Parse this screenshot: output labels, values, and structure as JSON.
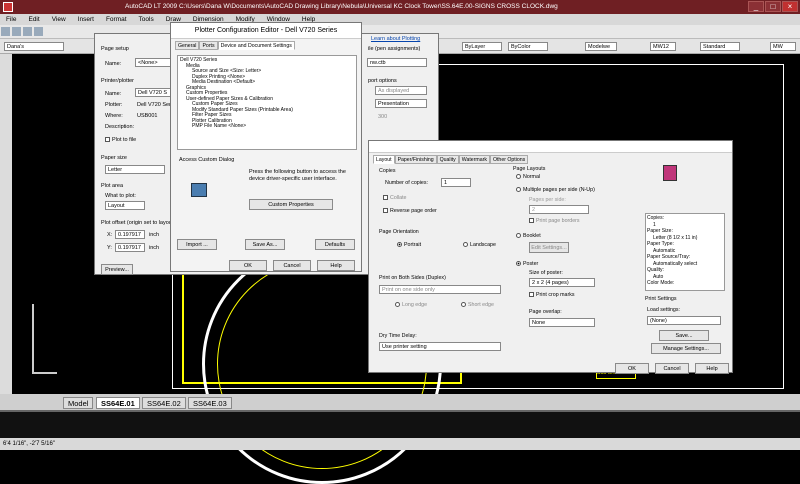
{
  "window": {
    "title": "AutoCAD LT 2009 C:\\Users\\Dana W\\Documents\\AutoCAD Drawing Library\\Nebula\\Universal KC Clock Tower\\SS.64E.00-SIGNS CROSS CLOCK.dwg"
  },
  "menu": [
    "File",
    "Edit",
    "View",
    "Insert",
    "Format",
    "Tools",
    "Draw",
    "Dimension",
    "Modify",
    "Window",
    "Help"
  ],
  "toolbar": {
    "workspace": "Dana's",
    "layer": "ByLayer",
    "color": "ByColor",
    "model": "Modelwe",
    "dimstyle1": "MW12",
    "textstyle": "Standard",
    "dimstyle2": "MW12",
    "mw": "MW"
  },
  "layout_tabs": [
    "Model",
    "SS64E.01",
    "SS64E.02",
    "SS64E.03"
  ],
  "status": {
    "coords": "6'4 1/16\", -2'7 5/16\""
  },
  "plot_dialog": {
    "page_setup_label": "Page setup",
    "name_label": "Name:",
    "name_value": "<None>",
    "printer_label": "Printer/plotter",
    "pname_label": "Name:",
    "pname_value": "Dell V720 S",
    "plotter_label": "Plotter:",
    "plotter_value": "Dell V720 Seri",
    "where_label": "Where:",
    "where_value": "USB001",
    "desc_label": "Description:",
    "plot_to_file": "Plot to file",
    "paper_size_label": "Paper size",
    "paper_size_value": "Letter",
    "plot_area_label": "Plot area",
    "what_label": "What to plot:",
    "what_value": "Layout",
    "offset_label": "Plot offset (origin set to layou",
    "x_label": "X:",
    "x_value": "0.197917",
    "x_unit": "inch",
    "y_label": "Y:",
    "y_value": "0.197917",
    "y_unit": "inch",
    "preview_btn": "Preview...",
    "learn": "Learn about Plotting",
    "pen_label": "ile (pen assignments)",
    "pen_value": "nw.ctb",
    "port_label": "port options",
    "port_value": "As displayed",
    "pres_value": "Presentation",
    "dpi": "300"
  },
  "pce": {
    "title": "Plotter Configuration Editor - Dell V720 Series",
    "tabs": [
      "General",
      "Ports",
      "Device and Document Settings"
    ],
    "tree": [
      "Dell V720 Series",
      "Media",
      "Source and Size <Size: Letter>",
      "Duplex Printing <None>",
      "Media Destination <Default>",
      "Graphics",
      "Custom Properties",
      "User-defined Paper Sizes & Calibration",
      "Custom Paper Sizes",
      "Modify Standard Paper Sizes (Printable Area)",
      "Filter Paper Sizes",
      "Plotter Calibration",
      "PMP File Name <None>"
    ],
    "access_label": "Access Custom Dialog",
    "access_text": "Press the following button to access the device driver-specific user interface.",
    "custom_btn": "Custom Properties",
    "import_btn": "Import ...",
    "saveas_btn": "Save As...",
    "defaults_btn": "Defaults",
    "ok_btn": "OK",
    "cancel_btn": "Cancel",
    "help_btn": "Help"
  },
  "props": {
    "tabs": [
      "Layout",
      "Paper/Finishing",
      "Quality",
      "Watermark",
      "Other Options"
    ],
    "copies_label": "Copies",
    "num_copies_label": "Number of copies:",
    "num_copies": "1",
    "collate": "Collate",
    "reverse": "Reverse page order",
    "orient_label": "Page Orientation",
    "portrait": "Portrait",
    "landscape": "Landscape",
    "duplex_label": "Print on Both Sides (Duplex)",
    "duplex_value": "Print on one side only",
    "long_edge": "Long edge",
    "short_edge": "Short edge",
    "dry_label": "Dry Time Delay:",
    "dry_value": "Use printer setting",
    "layouts_label": "Page Layouts",
    "normal": "Normal",
    "multiple": "Multiple pages per side (N-Up)",
    "pps_label": "Pages per side:",
    "pps_value": "2",
    "borders": "Print page borders",
    "booklet": "Booklet",
    "edit_settings": "Edit Settings...",
    "poster": "Poster",
    "poster_size_label": "Size of poster:",
    "poster_size": "2 x 2 (4 pages)",
    "crop": "Print crop marks",
    "overlap_label": "Page overlap:",
    "overlap_value": "None",
    "summary": [
      "Copies:",
      "1",
      "Paper Size:",
      "Letter (8 1/2 x 11 in)",
      "Paper Type:",
      "Automatic",
      "Paper Source/Tray:",
      "Automatically select",
      "Quality:",
      "Auto",
      "Color Mode:"
    ],
    "print_settings_label": "Print Settings",
    "load_label": "Load settings:",
    "load_value": "(None)",
    "save_btn": "Save...",
    "manage_btn": "Manage Settings...",
    "ok_btn": "OK",
    "cancel_btn": "Cancel",
    "help_btn": "Help"
  },
  "drawing": {
    "label": "SS64E.01"
  }
}
